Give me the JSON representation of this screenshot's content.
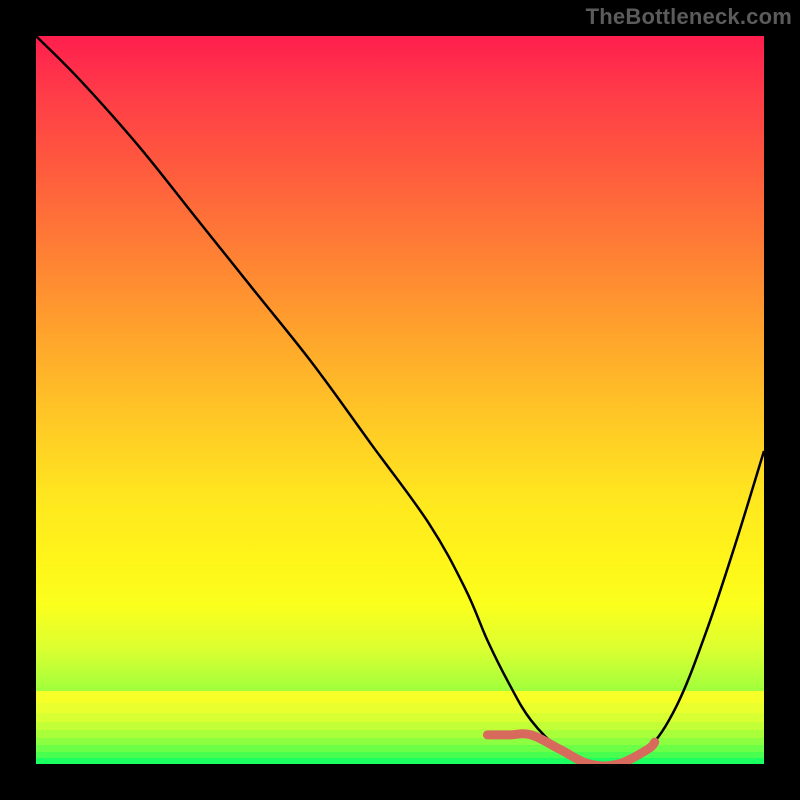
{
  "watermark": "TheBottleneck.com",
  "chart_data": {
    "type": "line",
    "title": "",
    "xlabel": "",
    "ylabel": "",
    "xlim": [
      0,
      100
    ],
    "ylim": [
      0,
      100
    ],
    "series": [
      {
        "name": "curve",
        "x": [
          0,
          6,
          14,
          22,
          30,
          38,
          46,
          54,
          59,
          62,
          65,
          68,
          72,
          76,
          80,
          84,
          88,
          92,
          96,
          100
        ],
        "y": [
          100,
          94,
          85,
          75,
          65,
          55,
          44,
          33,
          24,
          17,
          11,
          6,
          2,
          0,
          0,
          2,
          8,
          18,
          30,
          43
        ]
      }
    ],
    "optimal_range_x": [
      62,
      85
    ],
    "highlight_y": 0,
    "gradient_colors": {
      "top": "#ff1e4e",
      "mid1": "#ff9a2e",
      "mid2": "#fff51a",
      "bottom": "#1bff60"
    }
  },
  "bottom_bands": [
    {
      "h": 12,
      "color": "#f7ff28"
    },
    {
      "h": 10,
      "color": "#e9ff2e"
    },
    {
      "h": 9,
      "color": "#d8ff32"
    },
    {
      "h": 8,
      "color": "#c3ff36"
    },
    {
      "h": 8,
      "color": "#a8ff3a"
    },
    {
      "h": 7,
      "color": "#8cff40"
    },
    {
      "h": 7,
      "color": "#6cff48"
    },
    {
      "h": 6,
      "color": "#48ff50"
    },
    {
      "h": 6,
      "color": "#1bff60"
    }
  ]
}
